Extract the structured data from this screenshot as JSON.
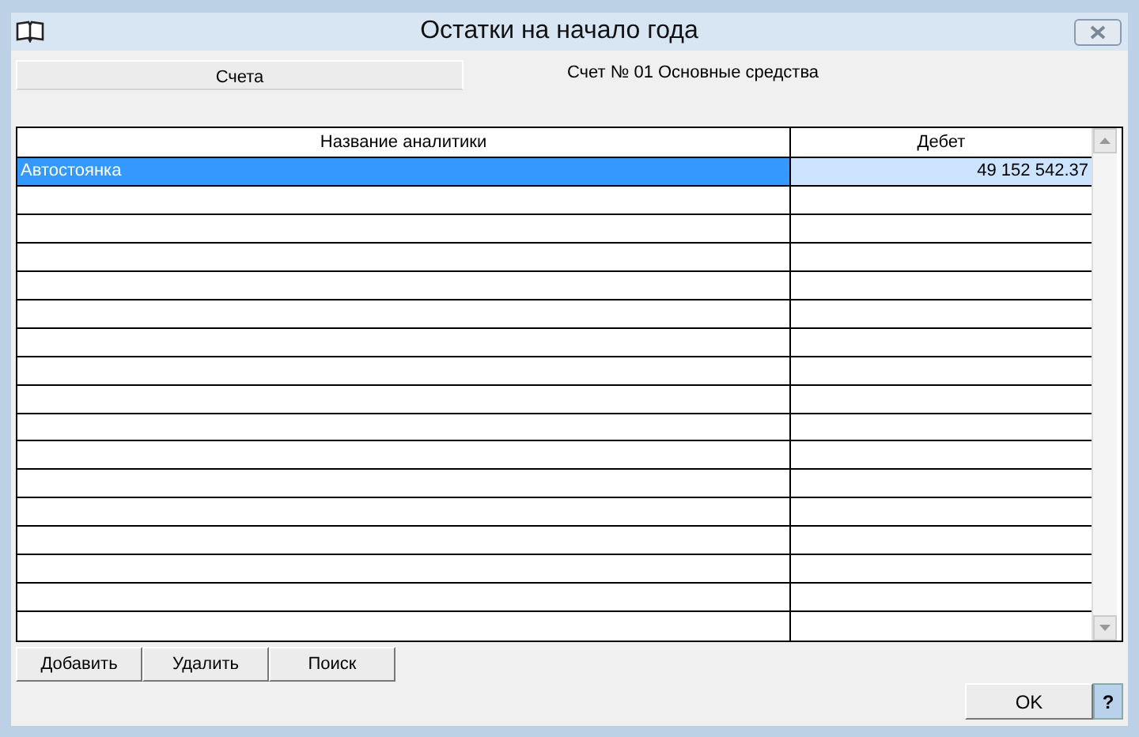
{
  "window": {
    "title": "Остатки на начало года"
  },
  "tabs": [
    {
      "label": "Счета",
      "selected": false
    },
    {
      "label": "Счет № 01 Основные средства",
      "selected": true
    }
  ],
  "table": {
    "columns": [
      "Название аналитики",
      "Дебет"
    ],
    "rows": [
      {
        "cells": [
          "Автостоянка",
          "49 152 542.37"
        ],
        "selected": true
      }
    ]
  },
  "buttons": [
    "Добавить",
    "Удалить",
    "Поиск"
  ],
  "ok_button": "OK",
  "help_button": "?"
}
